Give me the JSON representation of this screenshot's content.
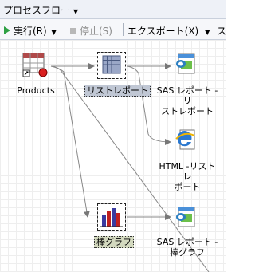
{
  "header": {
    "title": "プロセスフロー"
  },
  "toolbar": {
    "run_label": "実行(R)",
    "stop_label": "停止(S)",
    "export_label": "エクスポート(X)",
    "more_label": "ス"
  },
  "nodes": {
    "products": "Products",
    "list_report": "リストレポート",
    "sas_report_1_line1": "SAS レポート - リ",
    "sas_report_1_line2": "ストレポート",
    "html_line1": "HTML -リストレ",
    "html_line2": "ポート",
    "bar_chart": "棒グラフ",
    "sas_report_2_line1": "SAS レポート -",
    "sas_report_2_line2": "棒グラフ"
  },
  "colors": {
    "accent_run": "#2ea043",
    "canvas_grid": "#eeeeee",
    "selection_fill": "#c0c7d4"
  }
}
